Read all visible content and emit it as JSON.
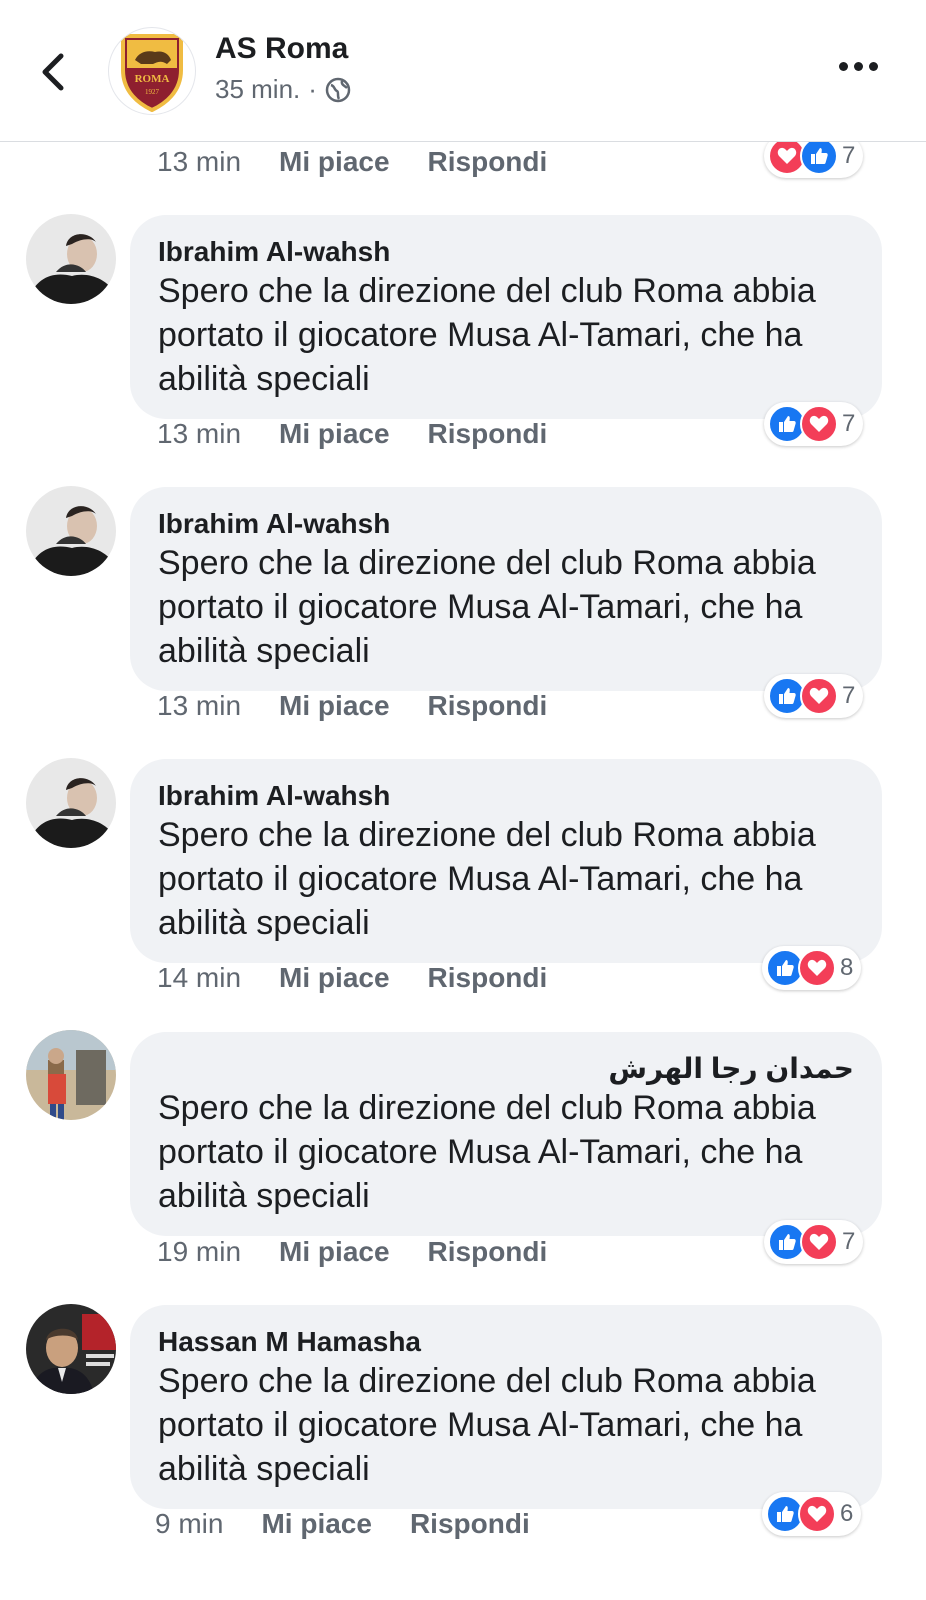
{
  "header": {
    "page_name": "AS Roma",
    "timestamp": "35 min.",
    "separator": "·",
    "logo_text": "ROMA",
    "logo_year": "1927"
  },
  "top_partial": {
    "time": "13 min",
    "like_label": "Mi piace",
    "reply_label": "Rispondi",
    "reaction_count": "7",
    "reactions": [
      "love",
      "like"
    ]
  },
  "comments": [
    {
      "author": "Ibrahim Al-wahsh",
      "text": "Spero che la direzione del club Roma abbia portato il giocatore Musa Al-Tamari, che ha abilità speciali",
      "time": "13 min",
      "like_label": "Mi piace",
      "reply_label": "Rispondi",
      "reaction_count": "7",
      "reactions": [
        "like",
        "love"
      ]
    },
    {
      "author": "Ibrahim Al-wahsh",
      "text": "Spero che la direzione del club Roma abbia portato il giocatore Musa Al-Tamari, che ha abilità speciali",
      "time": "13 min",
      "like_label": "Mi piace",
      "reply_label": "Rispondi",
      "reaction_count": "7",
      "reactions": [
        "like",
        "love"
      ]
    },
    {
      "author": "Ibrahim Al-wahsh",
      "text": "Spero che la direzione del club Roma abbia portato il giocatore Musa Al-Tamari, che ha abilità speciali",
      "time": "14 min",
      "like_label": "Mi piace",
      "reply_label": "Rispondi",
      "reaction_count": "8",
      "reactions": [
        "like",
        "love"
      ]
    },
    {
      "author": "حمدان رجا الهرش",
      "text": "Spero che la direzione del club Roma abbia portato il giocatore Musa Al-Tamari, che ha abilità speciali",
      "time": "19 min",
      "like_label": "Mi piace",
      "reply_label": "Rispondi",
      "reaction_count": "7",
      "reactions": [
        "like",
        "love"
      ]
    },
    {
      "author": "Hassan M Hamasha",
      "text": "Spero che la direzione del club Roma abbia portato il giocatore Musa Al-Tamari, che ha abilità speciali",
      "time": "9 min",
      "like_label": "Mi piace",
      "reply_label": "Rispondi",
      "reaction_count": "6",
      "reactions": [
        "like",
        "love"
      ]
    }
  ],
  "colors": {
    "like": "#1877f2",
    "love": "#f33e58",
    "bubble": "#f0f2f5",
    "meta_text": "#606770",
    "roma_red": "#8e1f2f",
    "roma_gold": "#f0bc42"
  }
}
